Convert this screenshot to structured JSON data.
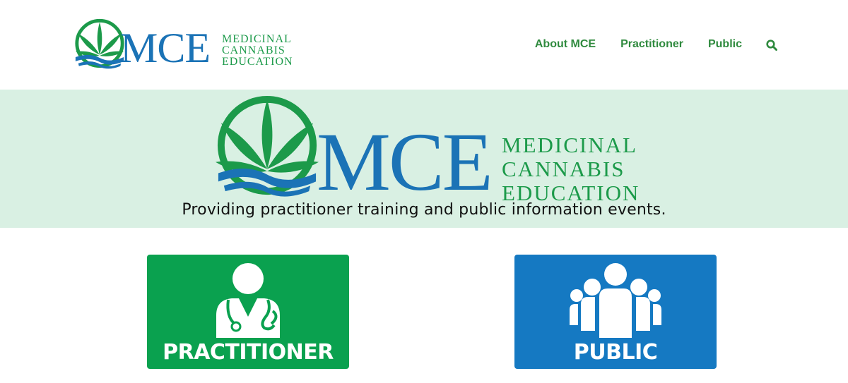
{
  "header": {
    "logo": {
      "mark_text": "MCE",
      "subtitle_lines": [
        "MEDICINAL",
        "CANNABIS",
        "EDUCATION"
      ]
    },
    "nav": [
      {
        "label": "About MCE"
      },
      {
        "label": "Practitioner"
      },
      {
        "label": "Public"
      }
    ],
    "search_icon": "search-icon"
  },
  "hero": {
    "logo": {
      "mark_text": "MCE",
      "subtitle_lines": [
        "MEDICINAL",
        "CANNABIS",
        "EDUCATION"
      ]
    },
    "tagline": "Providing practitioner training and public information events."
  },
  "cards": [
    {
      "label": "PRACTITIONER",
      "icon": "doctor-icon",
      "color": "#0aa14f"
    },
    {
      "label": "PUBLIC",
      "icon": "group-icon",
      "color": "#1579c2"
    }
  ],
  "colors": {
    "brand_blue": "#1b73b6",
    "brand_green": "#1c9a4a",
    "hero_bg": "#d9f0e3",
    "nav_text": "#2f8a3e"
  }
}
